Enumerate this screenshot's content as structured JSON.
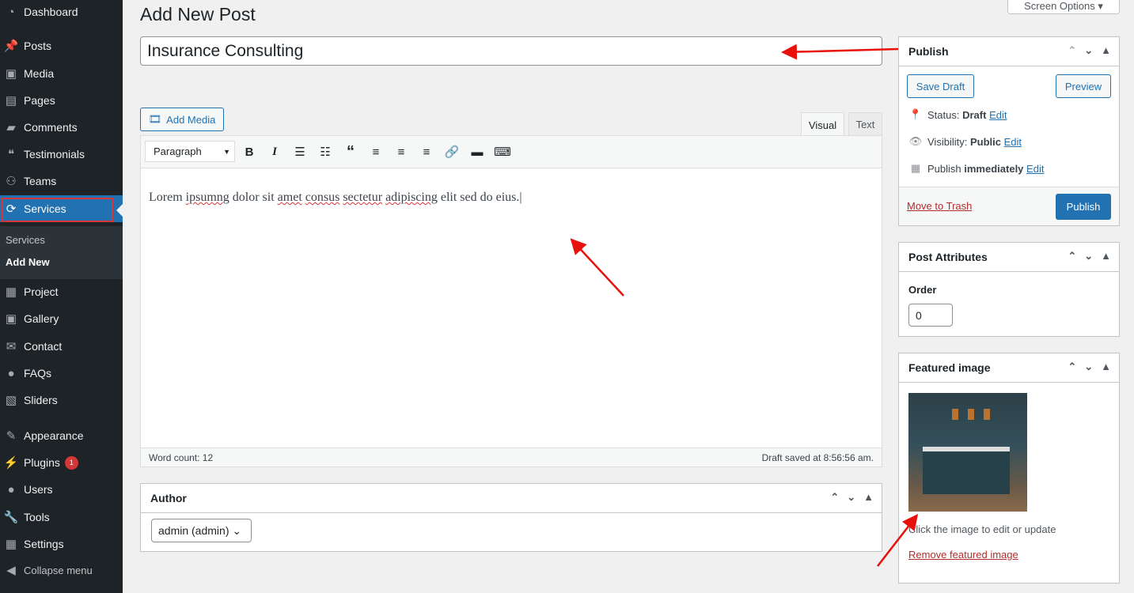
{
  "sidebar": {
    "items": [
      {
        "label": "Dashboard",
        "icon": "dashboard-icon"
      },
      {
        "label": "Posts",
        "icon": "pin-icon"
      },
      {
        "label": "Media",
        "icon": "media-icon"
      },
      {
        "label": "Pages",
        "icon": "pages-icon"
      },
      {
        "label": "Comments",
        "icon": "comment-icon"
      },
      {
        "label": "Testimonials",
        "icon": "testimonials-icon"
      },
      {
        "label": "Teams",
        "icon": "teams-icon"
      },
      {
        "label": "Services",
        "icon": "refresh-icon"
      },
      {
        "label": "Project",
        "icon": "project-icon"
      },
      {
        "label": "Gallery",
        "icon": "gallery-icon"
      },
      {
        "label": "Contact",
        "icon": "mail-icon"
      },
      {
        "label": "FAQs",
        "icon": "faq-icon"
      },
      {
        "label": "Sliders",
        "icon": "sliders-icon"
      },
      {
        "label": "Appearance",
        "icon": "brush-icon"
      },
      {
        "label": "Plugins",
        "icon": "plugin-icon",
        "badge": "1"
      },
      {
        "label": "Users",
        "icon": "user-icon"
      },
      {
        "label": "Tools",
        "icon": "wrench-icon"
      },
      {
        "label": "Settings",
        "icon": "settings-icon"
      },
      {
        "label": "Collapse menu",
        "icon": "collapse-icon"
      }
    ],
    "submenu": [
      "Services",
      "Add New"
    ]
  },
  "header": {
    "title": "Add New Post",
    "screen_options": "Screen Options"
  },
  "post": {
    "title": "Insurance Consulting",
    "add_media": "Add Media",
    "tabs": [
      "Visual",
      "Text"
    ],
    "format": "Paragraph",
    "content_words": [
      "Lorem ",
      "ipsumng",
      " dolor sit ",
      "amet",
      " ",
      "consus",
      " ",
      "sectetur",
      " ",
      "adipiscing",
      " elit sed do eius."
    ],
    "word_count": "Word count: 12",
    "draft_saved": "Draft saved at 8:56:56 am."
  },
  "publish": {
    "title": "Publish",
    "save_draft": "Save Draft",
    "preview": "Preview",
    "status_label": "Status:",
    "status": "Draft",
    "visibility_label": "Visibility:",
    "visibility": "Public",
    "publish_label": "Publish",
    "publish_when": "immediately",
    "edit": "Edit",
    "trash": "Move to Trash",
    "publish_btn": "Publish"
  },
  "attributes": {
    "title": "Post Attributes",
    "order_label": "Order",
    "order": "0"
  },
  "featured": {
    "title": "Featured image",
    "hint": "Click the image to edit or update",
    "remove": "Remove featured image"
  },
  "author": {
    "title": "Author",
    "value": "admin (admin)"
  },
  "colors": {
    "accent": "#2271b1",
    "sidebar": "#1d2327",
    "highlight": "#d63638"
  }
}
